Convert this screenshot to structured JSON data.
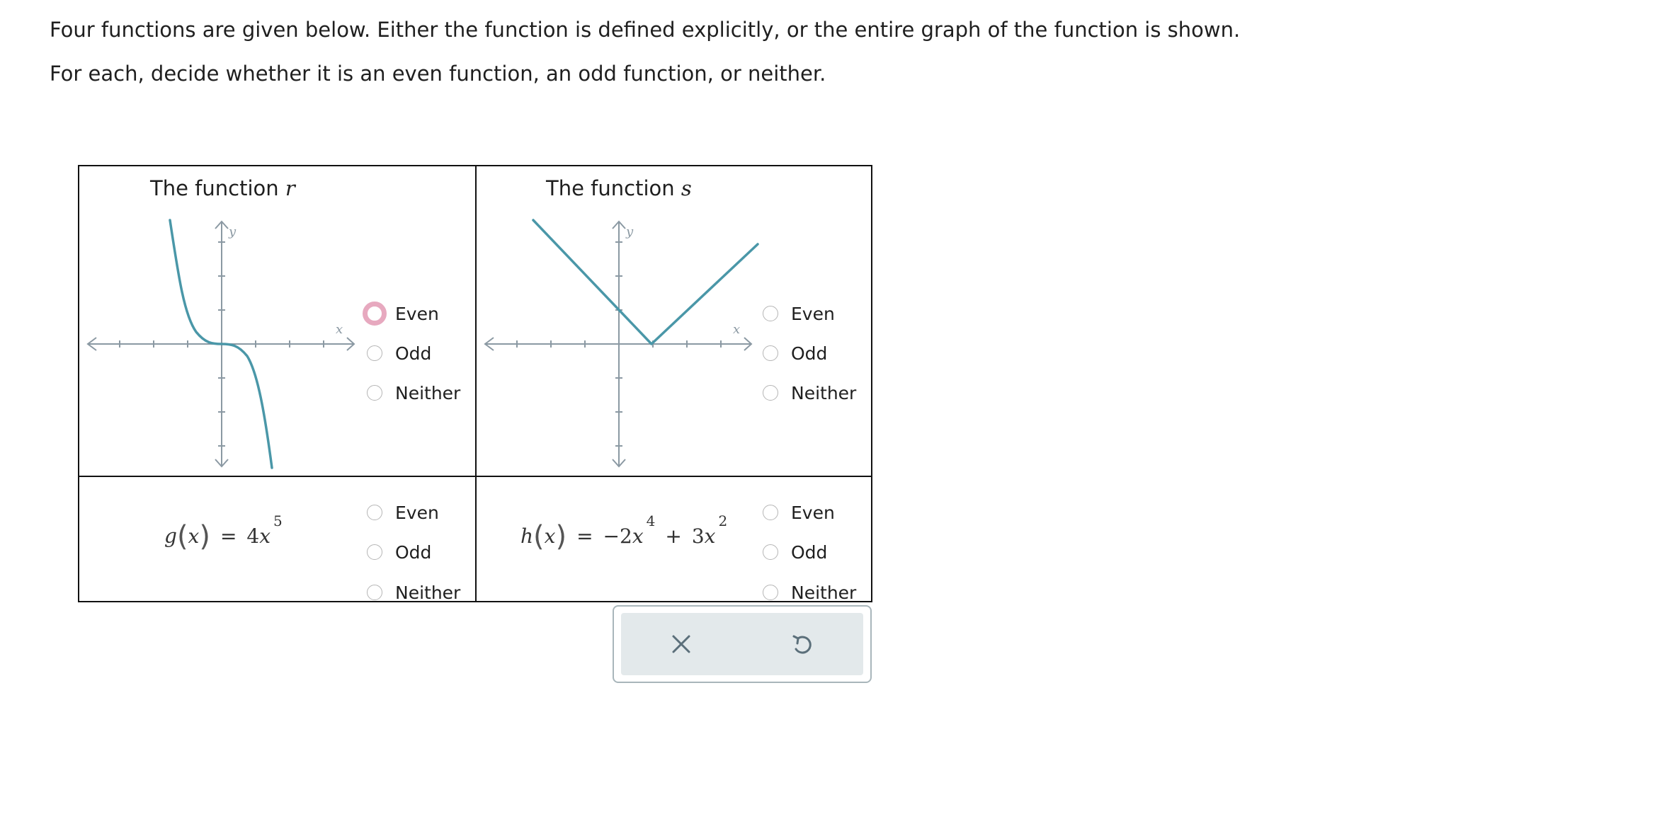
{
  "instructions": {
    "line1": "Four functions are given below. Either the function is defined explicitly, or the entire graph of the function is shown.",
    "line2": "For each, decide whether it is an even function, an odd function, or neither."
  },
  "cells": {
    "r": {
      "title": "The function",
      "var": "r",
      "axis_x": "x",
      "axis_y": "y",
      "options": [
        "Even",
        "Odd",
        "Neither"
      ]
    },
    "s": {
      "title": "The function",
      "var": "s",
      "axis_x": "x",
      "axis_y": "y",
      "options": [
        "Even",
        "Odd",
        "Neither"
      ]
    },
    "g": {
      "name": "g",
      "arg": "x",
      "eq": "=",
      "rhs_coef": "4",
      "rhs_var": "x",
      "rhs_exp": "5",
      "options": [
        "Even",
        "Odd",
        "Neither"
      ]
    },
    "h": {
      "name": "h",
      "arg": "x",
      "eq": "=",
      "t1_coef": "−2",
      "t1_var": "x",
      "t1_exp": "4",
      "op": "+",
      "t2_coef": "3",
      "t2_var": "x",
      "t2_exp": "2",
      "options": [
        "Even",
        "Odd",
        "Neither"
      ]
    }
  },
  "focused_option": "r-even",
  "actions": {
    "clear_icon": "x-icon",
    "undo_icon": "undo-icon"
  },
  "colors": {
    "curve": "#4a97a8",
    "axis": "#8b99a3",
    "focus_ring": "#e7a9bf",
    "action_bg": "#e3e9eb"
  }
}
